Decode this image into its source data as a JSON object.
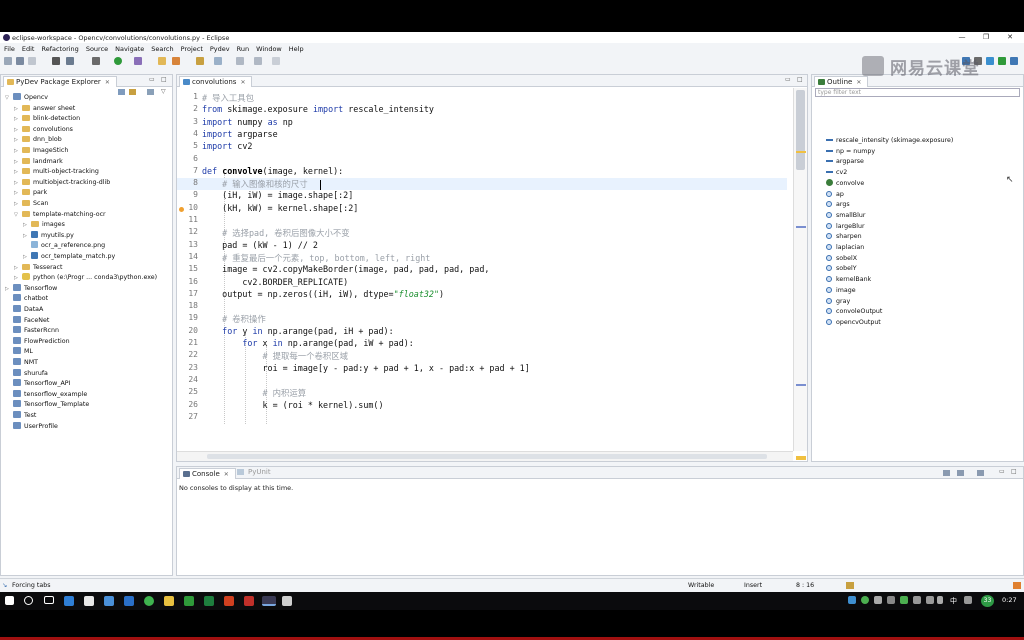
{
  "window": {
    "title": "eclipse-workspace - Opencv/convolutions/convolutions.py - Eclipse",
    "minimize": "—",
    "maximize": "❐",
    "close": "✕"
  },
  "menu": [
    "File",
    "Edit",
    "Refactoring",
    "Source",
    "Navigate",
    "Search",
    "Project",
    "Pydev",
    "Run",
    "Window",
    "Help"
  ],
  "explorer": {
    "title": "PyDev Package Explorer",
    "items": [
      {
        "label": "Opencv",
        "level": 0,
        "icon": "proj",
        "arrow": "open"
      },
      {
        "label": "answer sheet",
        "level": 1,
        "icon": "folder",
        "arrow": "closed"
      },
      {
        "label": "blink-detection",
        "level": 1,
        "icon": "folder",
        "arrow": "closed"
      },
      {
        "label": "convolutions",
        "level": 1,
        "icon": "folder",
        "arrow": "closed"
      },
      {
        "label": "dnn_blob",
        "level": 1,
        "icon": "folder",
        "arrow": "closed"
      },
      {
        "label": "ImageStich",
        "level": 1,
        "icon": "folder",
        "arrow": "closed"
      },
      {
        "label": "landmark",
        "level": 1,
        "icon": "folder",
        "arrow": "closed"
      },
      {
        "label": "multi-object-tracking",
        "level": 1,
        "icon": "folder",
        "arrow": "closed"
      },
      {
        "label": "multiobject-tracking-dlib",
        "level": 1,
        "icon": "folder",
        "arrow": "closed"
      },
      {
        "label": "park",
        "level": 1,
        "icon": "folder",
        "arrow": "closed"
      },
      {
        "label": "Scan",
        "level": 1,
        "icon": "folder",
        "arrow": "closed"
      },
      {
        "label": "template-matching-ocr",
        "level": 1,
        "icon": "folder",
        "arrow": "open"
      },
      {
        "label": "images",
        "level": 2,
        "icon": "folder",
        "arrow": "closed"
      },
      {
        "label": "myutils.py",
        "level": 2,
        "icon": "pyfile",
        "arrow": "closed"
      },
      {
        "label": "ocr_a_reference.png",
        "level": 2,
        "icon": "imgfile",
        "arrow": ""
      },
      {
        "label": "ocr_template_match.py",
        "level": 2,
        "icon": "pyfile",
        "arrow": "closed"
      },
      {
        "label": "Tesseract",
        "level": 1,
        "icon": "folder",
        "arrow": "closed"
      },
      {
        "label": "python  (e:\\Progr ... conda3\\python.exe)",
        "level": 1,
        "icon": "pyint",
        "arrow": "closed"
      },
      {
        "label": "Tensorflow",
        "level": 0,
        "icon": "proj",
        "arrow": "closed"
      },
      {
        "label": "chatbot",
        "level": 0,
        "icon": "proj",
        "arrow": ""
      },
      {
        "label": "DataA",
        "level": 0,
        "icon": "proj",
        "arrow": ""
      },
      {
        "label": "FaceNet",
        "level": 0,
        "icon": "proj",
        "arrow": ""
      },
      {
        "label": "FasterRcnn",
        "level": 0,
        "icon": "proj",
        "arrow": ""
      },
      {
        "label": "FlowPrediction",
        "level": 0,
        "icon": "proj",
        "arrow": ""
      },
      {
        "label": "ML",
        "level": 0,
        "icon": "proj",
        "arrow": ""
      },
      {
        "label": "NMT",
        "level": 0,
        "icon": "proj",
        "arrow": ""
      },
      {
        "label": "shurufa",
        "level": 0,
        "icon": "proj",
        "arrow": ""
      },
      {
        "label": "Tensorflow_API",
        "level": 0,
        "icon": "proj",
        "arrow": ""
      },
      {
        "label": "tensorflow_example",
        "level": 0,
        "icon": "proj",
        "arrow": ""
      },
      {
        "label": "Tensorflow_Template",
        "level": 0,
        "icon": "proj",
        "arrow": ""
      },
      {
        "label": "Test",
        "level": 0,
        "icon": "proj",
        "arrow": ""
      },
      {
        "label": "UserProfile",
        "level": 0,
        "icon": "proj",
        "arrow": ""
      }
    ]
  },
  "editor": {
    "tab": "convolutions",
    "lines": [
      {
        "n": "1",
        "tokens": [
          [
            "cm",
            "# 导入工具包"
          ]
        ]
      },
      {
        "n": "2",
        "tokens": [
          [
            "kw",
            "from"
          ],
          [
            "",
            " skimage.exposure "
          ],
          [
            "kw",
            "import"
          ],
          [
            "",
            " rescale_intensity"
          ]
        ]
      },
      {
        "n": "3",
        "tokens": [
          [
            "kw",
            "import"
          ],
          [
            "",
            " numpy "
          ],
          [
            "kw",
            "as"
          ],
          [
            "",
            " np"
          ]
        ]
      },
      {
        "n": "4",
        "tokens": [
          [
            "kw",
            "import"
          ],
          [
            "",
            " argparse"
          ]
        ]
      },
      {
        "n": "5",
        "tokens": [
          [
            "kw",
            "import"
          ],
          [
            "",
            " cv2"
          ]
        ]
      },
      {
        "n": "6",
        "tokens": []
      },
      {
        "n": "7",
        "tokens": [
          [
            "kw",
            "def"
          ],
          [
            "",
            " "
          ],
          [
            "fn",
            "convolve"
          ],
          [
            "",
            "(image, kernel):"
          ]
        ]
      },
      {
        "n": "8",
        "tokens": [
          [
            "",
            "    "
          ],
          [
            "cm",
            "# 输入图像和核的尺寸"
          ]
        ]
      },
      {
        "n": "9",
        "tokens": [
          [
            "",
            "    (iH, iW) = image.shape[:2]"
          ]
        ]
      },
      {
        "n": "10",
        "tokens": [
          [
            "",
            "    (kH, kW) = kernel.shape[:2]"
          ]
        ]
      },
      {
        "n": "11",
        "tokens": []
      },
      {
        "n": "12",
        "tokens": [
          [
            "",
            "    "
          ],
          [
            "cm",
            "# 选择pad, 卷积后图像大小不变"
          ]
        ]
      },
      {
        "n": "13",
        "tokens": [
          [
            "",
            "    pad = (kW - 1) // 2"
          ]
        ]
      },
      {
        "n": "14",
        "tokens": [
          [
            "",
            "    "
          ],
          [
            "cm",
            "# 重复最后一个元素, top, bottom, left, right"
          ]
        ]
      },
      {
        "n": "15",
        "tokens": [
          [
            "",
            "    image = cv2.copyMakeBorder(image, pad, pad, pad, pad,"
          ]
        ]
      },
      {
        "n": "16",
        "tokens": [
          [
            "",
            "        cv2.BORDER_REPLICATE)"
          ]
        ]
      },
      {
        "n": "17",
        "tokens": [
          [
            "",
            "    output = np.zeros((iH, iW), dtype="
          ],
          [
            "st",
            "\"float32\""
          ],
          [
            "",
            ")"
          ]
        ]
      },
      {
        "n": "18",
        "tokens": []
      },
      {
        "n": "19",
        "tokens": [
          [
            "",
            "    "
          ],
          [
            "cm",
            "# 卷积操作"
          ]
        ]
      },
      {
        "n": "20",
        "tokens": [
          [
            "",
            "    "
          ],
          [
            "kw",
            "for"
          ],
          [
            "",
            " y "
          ],
          [
            "kw",
            "in"
          ],
          [
            "",
            " np.arange(pad, iH + pad):"
          ]
        ]
      },
      {
        "n": "21",
        "tokens": [
          [
            "",
            "        "
          ],
          [
            "kw",
            "for"
          ],
          [
            "",
            " x "
          ],
          [
            "kw",
            "in"
          ],
          [
            "",
            " np.arange(pad, iW + pad):"
          ]
        ]
      },
      {
        "n": "22",
        "tokens": [
          [
            "",
            "            "
          ],
          [
            "cm",
            "# 提取每一个卷积区域"
          ]
        ]
      },
      {
        "n": "23",
        "tokens": [
          [
            "",
            "            roi = image[y - pad:y + pad + 1, x - pad:x + pad + 1]"
          ]
        ]
      },
      {
        "n": "24",
        "tokens": []
      },
      {
        "n": "25",
        "tokens": [
          [
            "",
            "            "
          ],
          [
            "cm",
            "# 内积运算"
          ]
        ]
      },
      {
        "n": "26",
        "tokens": [
          [
            "",
            "            k = (roi * kernel).sum()"
          ]
        ]
      },
      {
        "n": "27",
        "tokens": []
      }
    ]
  },
  "outline": {
    "title": "Outline",
    "filter_placeholder": "type filter text",
    "items": [
      {
        "label": "rescale_intensity (skimage.exposure)",
        "kind": "import"
      },
      {
        "label": "np = numpy",
        "kind": "import"
      },
      {
        "label": "argparse",
        "kind": "import"
      },
      {
        "label": "cv2",
        "kind": "import"
      },
      {
        "label": "convolve",
        "kind": "function"
      },
      {
        "label": "ap",
        "kind": "var"
      },
      {
        "label": "args",
        "kind": "var"
      },
      {
        "label": "smallBlur",
        "kind": "var"
      },
      {
        "label": "largeBlur",
        "kind": "var"
      },
      {
        "label": "sharpen",
        "kind": "var"
      },
      {
        "label": "laplacian",
        "kind": "var"
      },
      {
        "label": "sobelX",
        "kind": "var"
      },
      {
        "label": "sobelY",
        "kind": "var"
      },
      {
        "label": "kernelBank",
        "kind": "var"
      },
      {
        "label": "image",
        "kind": "var"
      },
      {
        "label": "gray",
        "kind": "var"
      },
      {
        "label": "convoleOutput",
        "kind": "var"
      },
      {
        "label": "opencvOutput",
        "kind": "var"
      }
    ]
  },
  "console": {
    "tab": "Console",
    "tab2": "PyUnit",
    "message": "No consoles to display at this time."
  },
  "status": {
    "left": "Forcing tabs",
    "writable": "Writable",
    "insert": "Insert",
    "position": "8 : 16"
  },
  "watermark": "网易云课堂",
  "taskbar": {
    "time": "0:27",
    "ime": "中",
    "badge": "33"
  }
}
